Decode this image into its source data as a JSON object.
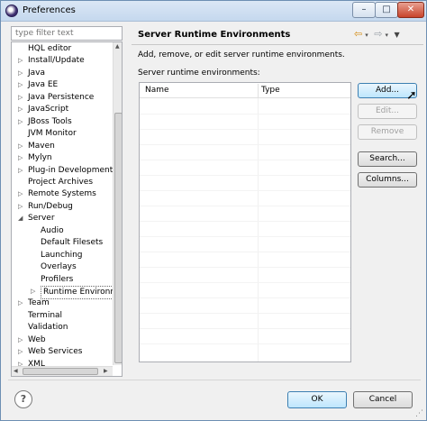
{
  "window": {
    "title": "Preferences"
  },
  "filter": {
    "placeholder": "type filter text"
  },
  "tree": {
    "items": [
      {
        "label": "HQL editor",
        "level": 1,
        "twisty": ""
      },
      {
        "label": "Install/Update",
        "level": 1,
        "twisty": "▷"
      },
      {
        "label": "Java",
        "level": 1,
        "twisty": "▷"
      },
      {
        "label": "Java EE",
        "level": 1,
        "twisty": "▷"
      },
      {
        "label": "Java Persistence",
        "level": 1,
        "twisty": "▷"
      },
      {
        "label": "JavaScript",
        "level": 1,
        "twisty": "▷"
      },
      {
        "label": "JBoss Tools",
        "level": 1,
        "twisty": "▷"
      },
      {
        "label": "JVM Monitor",
        "level": 1,
        "twisty": ""
      },
      {
        "label": "Maven",
        "level": 1,
        "twisty": "▷"
      },
      {
        "label": "Mylyn",
        "level": 1,
        "twisty": "▷"
      },
      {
        "label": "Plug-in Development",
        "level": 1,
        "twisty": "▷"
      },
      {
        "label": "Project Archives",
        "level": 1,
        "twisty": ""
      },
      {
        "label": "Remote Systems",
        "level": 1,
        "twisty": "▷"
      },
      {
        "label": "Run/Debug",
        "level": 1,
        "twisty": "▷"
      },
      {
        "label": "Server",
        "level": 1,
        "twisty": "◢"
      },
      {
        "label": "Audio",
        "level": 2,
        "twisty": ""
      },
      {
        "label": "Default Filesets",
        "level": 2,
        "twisty": ""
      },
      {
        "label": "Launching",
        "level": 2,
        "twisty": ""
      },
      {
        "label": "Overlays",
        "level": 2,
        "twisty": ""
      },
      {
        "label": "Profilers",
        "level": 2,
        "twisty": ""
      },
      {
        "label": "Runtime Environme",
        "level": 2,
        "twisty": "▷",
        "selected": true
      },
      {
        "label": "Team",
        "level": 1,
        "twisty": "▷"
      },
      {
        "label": "Terminal",
        "level": 1,
        "twisty": ""
      },
      {
        "label": "Validation",
        "level": 1,
        "twisty": ""
      },
      {
        "label": "Web",
        "level": 1,
        "twisty": "▷"
      },
      {
        "label": "Web Services",
        "level": 1,
        "twisty": "▷"
      },
      {
        "label": "XML",
        "level": 1,
        "twisty": "▷"
      }
    ]
  },
  "page": {
    "title": "Server Runtime Environments",
    "description": "Add, remove, or edit server runtime environments.",
    "list_label": "Server runtime environments:",
    "columns": [
      "Name",
      "Type"
    ]
  },
  "buttons": {
    "add": "Add...",
    "edit": "Edit...",
    "remove": "Remove",
    "search": "Search...",
    "columns": "Columns..."
  },
  "footer": {
    "help": "?",
    "ok": "OK",
    "cancel": "Cancel"
  },
  "icons": {
    "back": "back-arrow-icon",
    "forward": "forward-arrow-icon",
    "menu": "dropdown-icon"
  }
}
